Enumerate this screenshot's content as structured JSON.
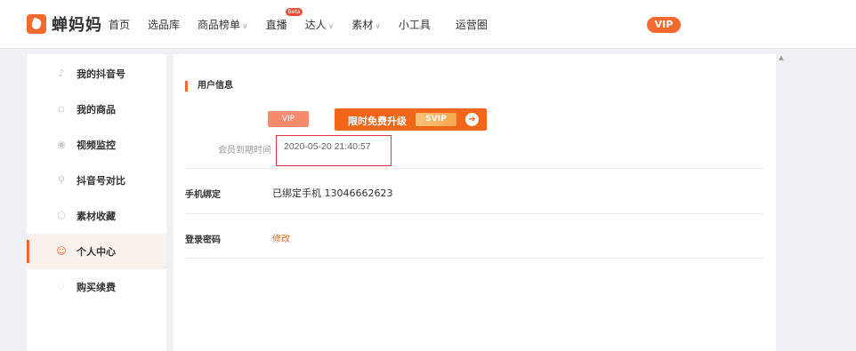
{
  "header": {
    "logo_text": "蝉妈妈",
    "nav": [
      {
        "label": "首页",
        "caret": false
      },
      {
        "label": "选品库",
        "caret": false
      },
      {
        "label": "商品榜单",
        "caret": true
      },
      {
        "label": "直播",
        "caret": false,
        "badge": "Beta"
      },
      {
        "label": "达人",
        "caret": true
      },
      {
        "label": "素材",
        "caret": true
      },
      {
        "label": "小工具",
        "caret": false
      },
      {
        "label": "运营圈",
        "caret": false
      }
    ],
    "vip_label": "VIP",
    "accent_color": "#f26a2e"
  },
  "sidebar": {
    "items": [
      {
        "label": "我的抖音号",
        "icon": "tiktok-icon",
        "active": false
      },
      {
        "label": "我的商品",
        "icon": "product-icon",
        "active": false
      },
      {
        "label": "视频监控",
        "icon": "monitor-icon",
        "active": false
      },
      {
        "label": "抖音号对比",
        "icon": "compare-icon",
        "active": false
      },
      {
        "label": "素材收藏",
        "icon": "box-icon",
        "active": false
      },
      {
        "label": "个人中心",
        "icon": "user-icon",
        "active": true
      },
      {
        "label": "购买续费",
        "icon": "diamond-icon",
        "active": false
      }
    ]
  },
  "main": {
    "section_title": "用户信息",
    "vip_tag": "VIP",
    "upgrade": {
      "text": "限时免费升级",
      "chip": "SVIP"
    },
    "expire": {
      "label": "会员到期时间",
      "value": "2020-05-20 21:40:57"
    },
    "phone": {
      "label": "手机绑定",
      "value": "已绑定手机 13046662623"
    },
    "password": {
      "label": "登录密码",
      "link": "修改"
    }
  }
}
